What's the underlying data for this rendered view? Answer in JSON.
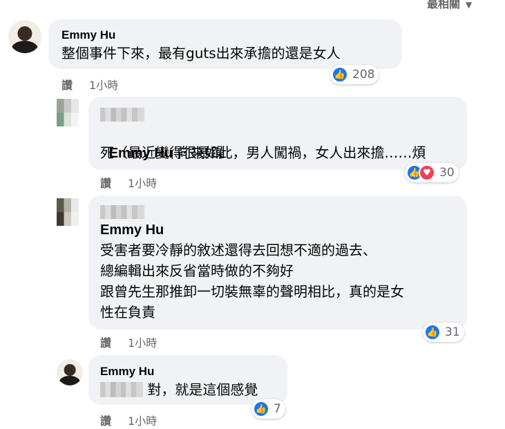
{
  "sort_label": "最相關",
  "comments": [
    {
      "author": "Emmy Hu",
      "text": "整個事件下來，最有guts出來承擔的還是女人",
      "reactions": "208",
      "read_label": "讚",
      "time": "1小時"
    },
    {
      "author": "",
      "mention": "Emmy Hu",
      "text": " 向來如此，男人闖禍，女人出來擔……煩",
      "text2": "死（最近變得很暴躁",
      "reactions": "30",
      "read_label": "讚",
      "time": "1小時"
    },
    {
      "author": "",
      "mention": "Emmy Hu",
      "lines": [
        "受害者要冷靜的敘述還得去回想不適的過去、",
        "總編輯出來反省當時做的不夠好",
        "跟曾先生那推卸一切裝無辜的聲明相比，真的是女",
        "性在負責"
      ],
      "reactions": "31",
      "read_label": "讚",
      "time": "1小時"
    },
    {
      "author": "Emmy Hu",
      "text": " 對，就是這個感覺",
      "reactions": "7",
      "read_label": "讚",
      "time": "1小時"
    }
  ],
  "icons": {
    "like": "like-icon",
    "love": "love-icon",
    "chevron": "chevron-down-icon"
  },
  "colors": {
    "bubble": "#f0f2f5",
    "like_blue": "#1877f2",
    "love_red": "#f33e58",
    "meta_gray": "#65676b"
  }
}
